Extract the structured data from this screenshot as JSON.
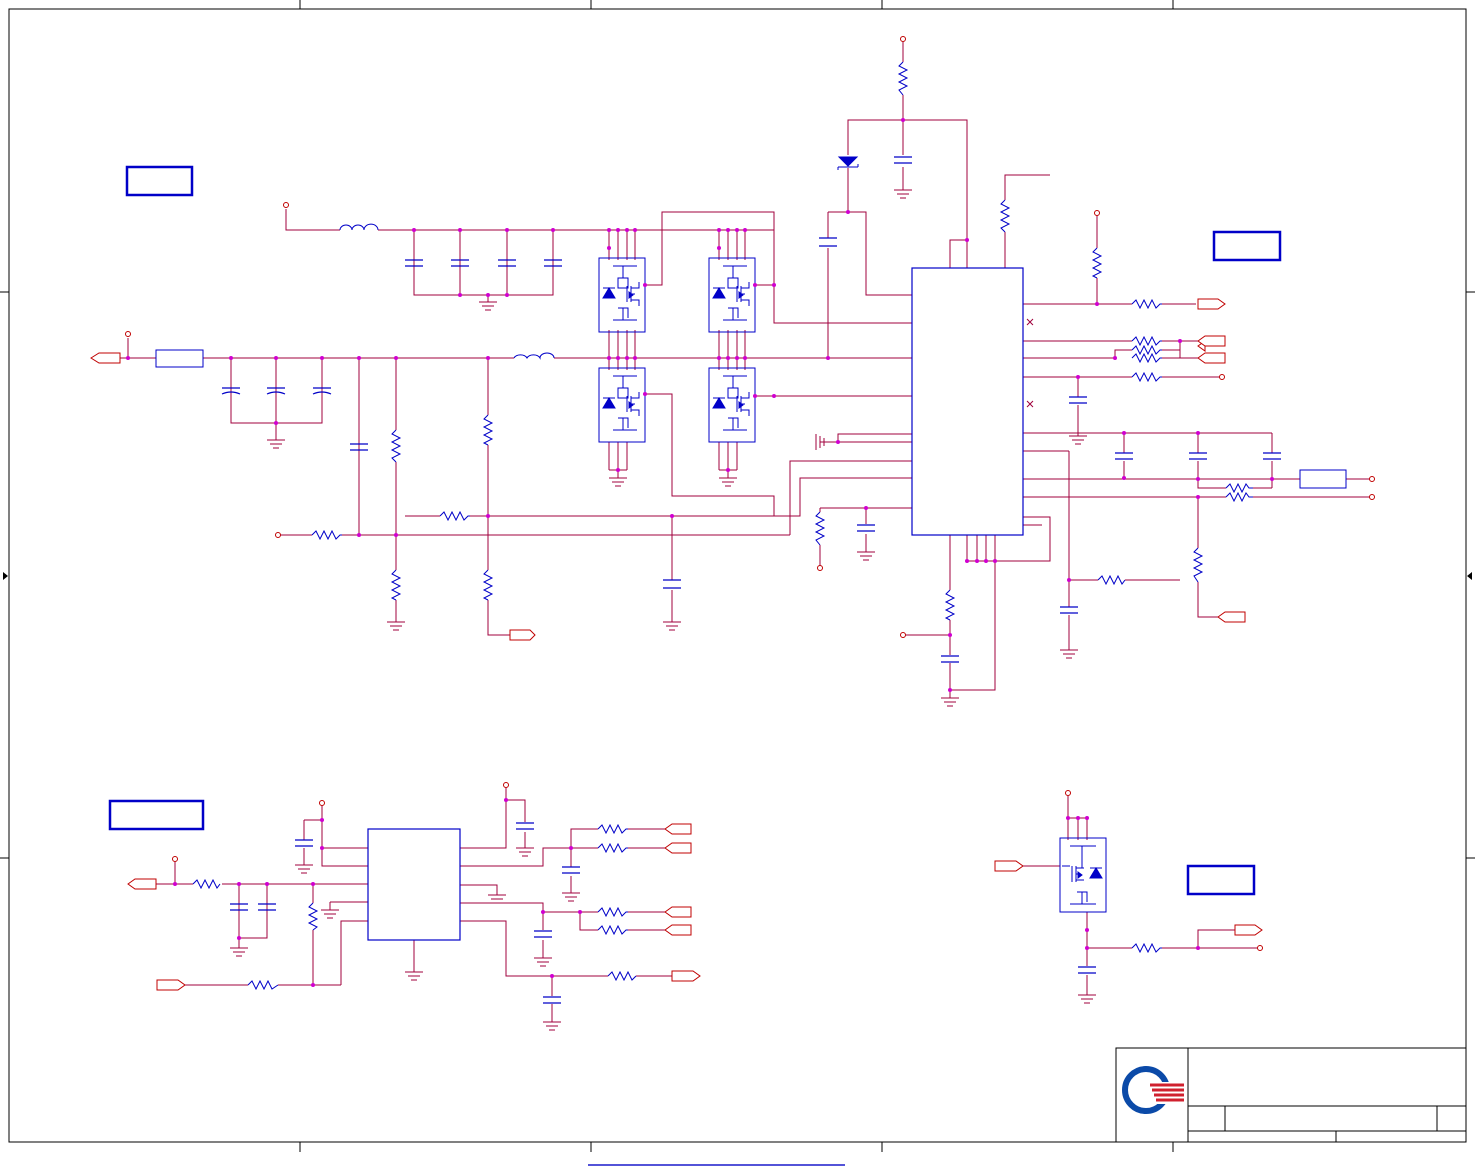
{
  "sheet": {
    "border_color": "#000000",
    "wire_color": "#a0003c",
    "part_color": "#0000c8",
    "junction_color": "#d000d0",
    "signal_color": "#d00000"
  },
  "blocks": [
    {
      "id": "block-top-left",
      "text": ""
    },
    {
      "id": "block-top-right",
      "text": ""
    },
    {
      "id": "block-bottom-left",
      "text": ""
    },
    {
      "id": "block-bottom-right",
      "text": ""
    }
  ],
  "title_block": {
    "logo": "quanta-logo",
    "logo_colors": [
      "#0b4aa8",
      "#d0202e"
    ],
    "title": "",
    "size": "",
    "document_number": "",
    "revision": "",
    "date": "",
    "sheet": ""
  },
  "icons": [
    "resistor-icon",
    "capacitor-icon",
    "inductor-icon",
    "ground-icon",
    "power-pin-icon",
    "mosfet-icon",
    "diode-icon",
    "off-page-connector-icon"
  ]
}
